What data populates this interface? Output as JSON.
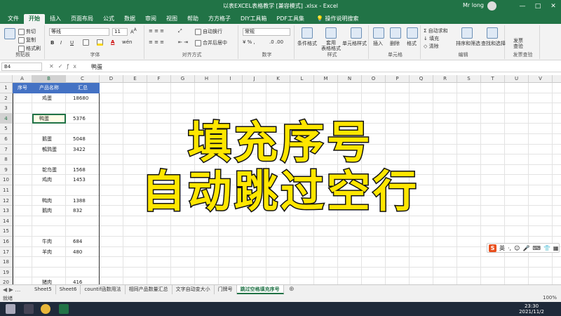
{
  "titlebar": {
    "title": "以表EXCEL表格教学 [兼容模式] .xlsx - Excel",
    "user": "Mr long",
    "buttons": [
      "—",
      "□",
      "✕"
    ]
  },
  "menu": {
    "tabs": [
      "文件",
      "开始",
      "插入",
      "页面布局",
      "公式",
      "数据",
      "审阅",
      "视图",
      "帮助",
      "方方格子",
      "DIY工具箱",
      "PDF工具集"
    ],
    "active_index": 1,
    "tell_me": "操作说明搜索"
  },
  "ribbon": {
    "clipboard": {
      "cut": "剪切",
      "copy": "复制",
      "painter": "格式刷",
      "name": "剪贴板"
    },
    "font": {
      "family": "等线",
      "size": "11",
      "bold": "B",
      "italic": "I",
      "underline": "U",
      "name": "字体"
    },
    "align": {
      "wrap": "自动换行",
      "merge": "合并后居中",
      "name": "对齐方式"
    },
    "number": {
      "format": "常规",
      "name": "数字"
    },
    "styles": {
      "cond": "条件格式",
      "table": "套用\n表格格式",
      "cell": "单元格样式",
      "name": "样式"
    },
    "cells": {
      "insert": "插入",
      "delete": "删除",
      "format": "格式",
      "name": "单元格"
    },
    "editing": {
      "autosum": "自动求和",
      "fill": "填充",
      "clear": "清除",
      "sort": "排序和筛选",
      "find": "查找和选择",
      "name": "编辑"
    },
    "invoice": {
      "label": "发票\n查验",
      "name": "发票查验"
    }
  },
  "formula": {
    "namebox": "B4",
    "content": "鸭蛋"
  },
  "columns": [
    "A",
    "B",
    "C",
    "D",
    "E",
    "F",
    "G",
    "H",
    "I",
    "J",
    "K",
    "L",
    "M",
    "N",
    "O",
    "P",
    "Q",
    "R",
    "S",
    "T",
    "U",
    "V",
    "W"
  ],
  "rows": [
    "1",
    "2",
    "3",
    "4",
    "5",
    "6",
    "7",
    "8",
    "9",
    "10",
    "11",
    "12",
    "13",
    "14",
    "15",
    "16",
    "17",
    "18",
    "19",
    "20"
  ],
  "table": {
    "header": {
      "a": "序号",
      "b": "产品名称",
      "c": "汇总"
    },
    "data": [
      {
        "row": 2,
        "b": "鸡蛋",
        "c": "18680"
      },
      {
        "row": 4,
        "b": "鸭蛋",
        "c": "5376"
      },
      {
        "row": 6,
        "b": "鹅蛋",
        "c": "5048"
      },
      {
        "row": 7,
        "b": "鹌鹑蛋",
        "c": "3422"
      },
      {
        "row": 9,
        "b": "鸵鸟蛋",
        "c": "1568"
      },
      {
        "row": 10,
        "b": "鸡肉",
        "c": "1453"
      },
      {
        "row": 12,
        "b": "鸭肉",
        "c": "1388"
      },
      {
        "row": 13,
        "b": "鹅肉",
        "c": "832"
      },
      {
        "row": 16,
        "b": "牛肉",
        "c": "684"
      },
      {
        "row": 17,
        "b": "羊肉",
        "c": "480"
      },
      {
        "row": 20,
        "b": "猪肉",
        "c": "416"
      }
    ]
  },
  "overlay": {
    "line1": "填充序号",
    "line2": "自动跳过空行"
  },
  "ime": {
    "logo": "S",
    "mode": "英"
  },
  "sheets": [
    "Sheet5",
    "Sheet6",
    "countif函数用法",
    "相同产品数量汇总",
    "文字自动变大小",
    "门牌号",
    "跳过空格填充序号"
  ],
  "active_sheet": 6,
  "status": {
    "ready": "就绪",
    "zoom": "100%"
  },
  "taskbar": {
    "time": "23:30",
    "date": "2021/11/2"
  },
  "colors": {
    "excel_green": "#217346",
    "header_blue": "#4472c4",
    "overlay_yellow": "#ffe600"
  }
}
